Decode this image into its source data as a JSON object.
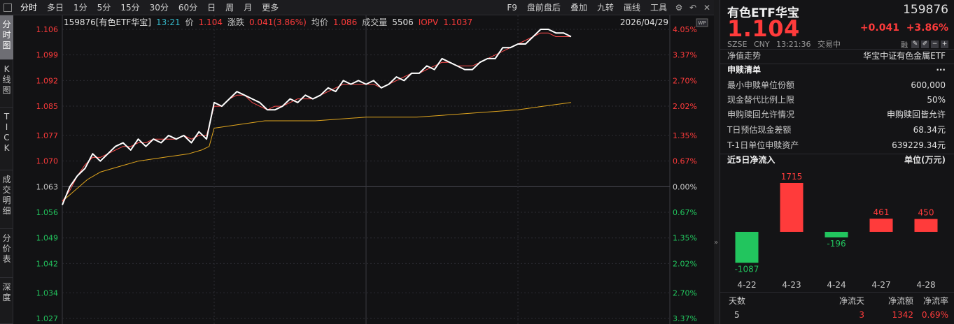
{
  "toolbar": {
    "items": [
      "分时",
      "多日",
      "1分",
      "5分",
      "15分",
      "30分",
      "60分",
      "日",
      "周",
      "月",
      "更多"
    ],
    "right_items": [
      "F9",
      "盘前盘后",
      "叠加",
      "九转",
      "画线",
      "工具"
    ],
    "right_icons": [
      "gear-icon",
      "back-icon",
      "close-icon"
    ]
  },
  "vtabs": [
    {
      "label": "分时图",
      "active": true
    },
    {
      "label": "K线图",
      "active": false
    },
    {
      "label": "TICK",
      "active": false
    },
    {
      "label": "成交明细",
      "active": false
    },
    {
      "label": "分价表",
      "active": false
    },
    {
      "label": "深度",
      "active": false
    }
  ],
  "chart_header": {
    "code_name": "159876[有色ETF华宝]",
    "time": "13:21",
    "price_label": "价",
    "price": "1.104",
    "change_label": "涨跌",
    "change": "0.041(3.86%)",
    "avg_label": "均价",
    "avg": "1.086",
    "volume_label": "成交量",
    "volume": "5506",
    "iopv_label": "IOPV",
    "iopv": "1.1037",
    "date": "2026/04/29",
    "wp_badge": "WP"
  },
  "colors": {
    "up": "#ff3b3b",
    "down": "#22c55e",
    "price_line": "#ffffff",
    "avg_line": "#e0a51e",
    "iopv_line": "#ff4d4d",
    "time": "#35b8c9"
  },
  "chart_data": {
    "type": "line",
    "y_left_ticks": [
      "1.106",
      "1.099",
      "1.092",
      "1.085",
      "1.077",
      "1.070",
      "1.063",
      "1.056",
      "1.049",
      "1.042",
      "1.034",
      "1.027"
    ],
    "y_right_ticks": [
      "4.05%",
      "3.37%",
      "2.70%",
      "2.02%",
      "1.35%",
      "0.67%",
      "0.00%",
      "0.67%",
      "1.35%",
      "2.02%",
      "2.70%",
      "3.37%"
    ],
    "ylim": [
      1.027,
      1.106
    ],
    "base": 1.063,
    "x_range": [
      0,
      240
    ],
    "grid": true,
    "series": [
      {
        "role": "price",
        "x": [
          0,
          3,
          6,
          9,
          12,
          15,
          18,
          21,
          24,
          27,
          30,
          33,
          36,
          39,
          42,
          45,
          48,
          51,
          54,
          57,
          60,
          63,
          66,
          69,
          72,
          75,
          78,
          81,
          84,
          87,
          90,
          93,
          96,
          99,
          102,
          105,
          108,
          111,
          114,
          117,
          120,
          123,
          126,
          129,
          132,
          135,
          138,
          141,
          144,
          147,
          150,
          153,
          156,
          159,
          162,
          165,
          168,
          171,
          174,
          177,
          180,
          183,
          186,
          189,
          192,
          195,
          198,
          201
        ],
        "values": [
          1.058,
          1.063,
          1.066,
          1.068,
          1.072,
          1.07,
          1.072,
          1.074,
          1.075,
          1.073,
          1.076,
          1.074,
          1.076,
          1.075,
          1.077,
          1.076,
          1.077,
          1.075,
          1.078,
          1.076,
          1.086,
          1.085,
          1.087,
          1.089,
          1.088,
          1.087,
          1.086,
          1.084,
          1.084,
          1.085,
          1.087,
          1.086,
          1.088,
          1.087,
          1.088,
          1.09,
          1.089,
          1.092,
          1.091,
          1.092,
          1.091,
          1.092,
          1.09,
          1.091,
          1.093,
          1.092,
          1.094,
          1.094,
          1.096,
          1.095,
          1.098,
          1.097,
          1.096,
          1.095,
          1.095,
          1.097,
          1.098,
          1.098,
          1.101,
          1.101,
          1.102,
          1.102,
          1.104,
          1.106,
          1.106,
          1.105,
          1.105,
          1.104
        ]
      },
      {
        "role": "iopv",
        "x": [
          0,
          3,
          6,
          9,
          12,
          15,
          18,
          21,
          24,
          27,
          30,
          33,
          36,
          39,
          42,
          45,
          48,
          51,
          54,
          57,
          60,
          63,
          66,
          69,
          72,
          75,
          78,
          81,
          84,
          87,
          90,
          93,
          96,
          99,
          102,
          105,
          108,
          111,
          114,
          117,
          120,
          123,
          126,
          129,
          132,
          135,
          138,
          141,
          144,
          147,
          150,
          153,
          156,
          159,
          162,
          165,
          168,
          171,
          174,
          177,
          180,
          183,
          186,
          189,
          192,
          195,
          198,
          201
        ],
        "values": [
          1.059,
          1.062,
          1.066,
          1.069,
          1.071,
          1.071,
          1.072,
          1.073,
          1.074,
          1.074,
          1.075,
          1.075,
          1.076,
          1.076,
          1.076,
          1.076,
          1.077,
          1.076,
          1.077,
          1.077,
          1.085,
          1.085,
          1.087,
          1.088,
          1.088,
          1.086,
          1.085,
          1.084,
          1.085,
          1.085,
          1.086,
          1.087,
          1.087,
          1.087,
          1.088,
          1.089,
          1.09,
          1.091,
          1.091,
          1.091,
          1.091,
          1.091,
          1.09,
          1.091,
          1.092,
          1.093,
          1.094,
          1.094,
          1.095,
          1.096,
          1.097,
          1.097,
          1.096,
          1.096,
          1.096,
          1.097,
          1.098,
          1.099,
          1.1,
          1.101,
          1.102,
          1.103,
          1.104,
          1.105,
          1.105,
          1.104,
          1.104,
          1.104
        ]
      },
      {
        "role": "average",
        "x": [
          0,
          5,
          10,
          15,
          20,
          25,
          30,
          40,
          50,
          55,
          58,
          60,
          70,
          80,
          100,
          120,
          140,
          160,
          180,
          190,
          201
        ],
        "values": [
          1.059,
          1.062,
          1.065,
          1.067,
          1.068,
          1.069,
          1.07,
          1.071,
          1.072,
          1.073,
          1.074,
          1.079,
          1.08,
          1.081,
          1.081,
          1.082,
          1.082,
          1.083,
          1.084,
          1.085,
          1.086
        ]
      }
    ]
  },
  "panel": {
    "name": "有色ETF华宝",
    "code": "159876",
    "price": "1.104",
    "change": "+0.041",
    "change_pct": "+3.86%",
    "exchange": "SZSE",
    "currency": "CNY",
    "time": "13:21:36",
    "status": "交易中",
    "rong": "融",
    "nav_label": "净值走势",
    "nav_value": "华宝中证有色金属ETF",
    "sg_title": "申赎清单",
    "sg_more": "···",
    "sg_rows": [
      {
        "k": "最小申赎单位份额",
        "v": "600,000"
      },
      {
        "k": "现金替代比例上限",
        "v": "50%"
      },
      {
        "k": "申购赎回允许情况",
        "v": "申购赎回皆允许"
      },
      {
        "k": "T日预估现金差额",
        "v": "68.34元"
      },
      {
        "k": "T-1日单位申赎资产",
        "v": "639229.34元"
      }
    ],
    "flow_title": "近5日净流入",
    "flow_unit": "单位(万元)",
    "flow_data": {
      "type": "bar",
      "categories": [
        "4-22",
        "4-23",
        "4-24",
        "4-27",
        "4-28"
      ],
      "values": [
        -1087,
        1715,
        -196,
        461,
        450
      ],
      "labels": [
        "-1087",
        "1715",
        "-196",
        "461",
        "450"
      ]
    },
    "stats_heads": [
      "天数",
      "净流天",
      "净流额",
      "净流率"
    ],
    "stats_vals": [
      "5",
      "3",
      "1342",
      "0.69%"
    ]
  }
}
